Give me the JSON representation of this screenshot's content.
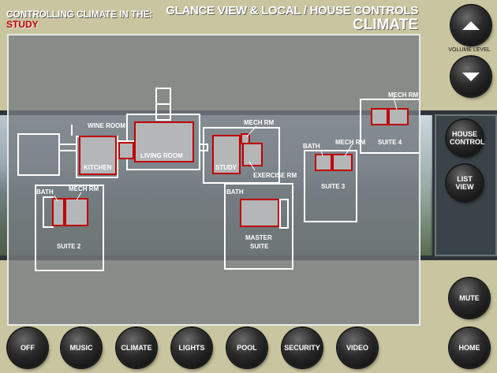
{
  "header": {
    "controlling_label": "CONTROLLING CLIMATE IN THE:",
    "current_room": "STUDY",
    "view_title": "GLANCE VIEW & LOCAL / HOUSE CONTROLS",
    "page_title": "CLIMATE"
  },
  "volume": {
    "label": "VOLUME LEVEL"
  },
  "side_buttons": {
    "house_control": "HOUSE CONTROL",
    "list_view": "LIST VIEW",
    "mute": "MUTE",
    "home": "HOME"
  },
  "bottom_nav": [
    "OFF",
    "MUSIC",
    "CLIMATE",
    "LIGHTS",
    "POOL",
    "SECURITY",
    "VIDEO"
  ],
  "rooms": {
    "wine_room": "WINE ROOM",
    "kitchen": "KITCHEN",
    "living_room": "LIVING ROOM",
    "study": "STUDY",
    "mech_rm_study": "MECH RM",
    "exercise_rm": "EXERCISE RM",
    "bath_suite2": "BATH",
    "mech_rm_suite2": "MECH RM",
    "suite2": "SUITE 2",
    "bath_master": "BATH",
    "master_suite_line1": "MASTER",
    "master_suite_line2": "SUITE",
    "bath_suite3": "BATH",
    "mech_rm_suite3": "MECH RM",
    "suite3": "SUITE 3",
    "mech_rm_suite4": "MECH RM",
    "suite4": "SUITE 4"
  },
  "colors": {
    "accent_red": "#c00000",
    "background": "#c9c5a0",
    "room_fill": "#b4b6b8"
  }
}
